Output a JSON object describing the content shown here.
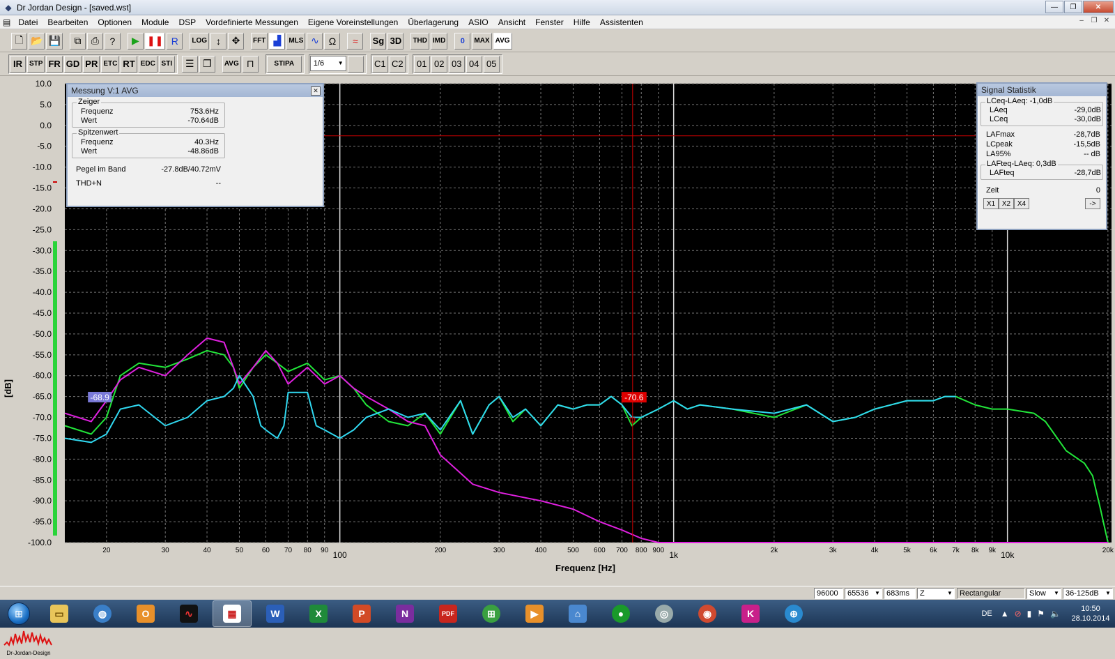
{
  "window": {
    "title": "Dr Jordan Design - [saved.wst]"
  },
  "menu": [
    "Datei",
    "Bearbeiten",
    "Optionen",
    "Module",
    "DSP",
    "Vordefinierte Messungen",
    "Eigene Voreinstellungen",
    "Überlagerung",
    "ASIO",
    "Ansicht",
    "Fenster",
    "Hilfe",
    "Assistenten"
  ],
  "toolbar1": [
    "LOG",
    "FFT",
    "MLS",
    "Sg",
    "3D",
    "THD",
    "IMD",
    "0",
    "MAX",
    "AVG",
    "R"
  ],
  "toolbar2": {
    "analysis_buttons": [
      "IR",
      "STP",
      "FR",
      "GD",
      "PR",
      "ETC",
      "RT",
      "EDC",
      "STI"
    ],
    "avg_label": "AVG",
    "stipa_label": "STIPA",
    "fraction": "1/6",
    "channels": [
      "C1",
      "C2"
    ],
    "slots": [
      "01",
      "02",
      "03",
      "04",
      "05"
    ]
  },
  "plot": {
    "y_axis_title": "[dB]",
    "x_axis_title": "Frequenz [Hz]",
    "y_ticks": [
      "10.0",
      "5.0",
      "0.0",
      "-5.0",
      "-10.0",
      "-15.0",
      "-20.0",
      "-25.0",
      "-30.0",
      "-35.0",
      "-40.0",
      "-45.0",
      "-50.0",
      "-55.0",
      "-60.0",
      "-65.0",
      "-70.0",
      "-75.0",
      "-80.0",
      "-85.0",
      "-90.0",
      "-95.0",
      "-100.0"
    ],
    "x_ticks": [
      "20",
      "30",
      "40",
      "50",
      "60",
      "70",
      "80",
      "90",
      "100",
      "200",
      "300",
      "400",
      "500",
      "600",
      "700",
      "800",
      "900",
      "1k",
      "2k",
      "3k",
      "4k",
      "5k",
      "6k",
      "7k",
      "8k",
      "9k",
      "10k",
      "20k"
    ],
    "cursor_label": "-70.6",
    "marker_label": "-68.9"
  },
  "chart_data": {
    "type": "line",
    "xlabel": "Frequenz [Hz]",
    "ylabel": "[dB]",
    "x_scale": "log",
    "xlim": [
      15,
      20500
    ],
    "ylim": [
      -100,
      10
    ],
    "grid": true,
    "cursor": {
      "frequency_hz": 753.6,
      "level_db": -70.6
    },
    "series": [
      {
        "color": "#22e63a",
        "x": [
          15,
          18,
          20,
          22,
          25,
          30,
          35,
          40,
          45,
          48,
          50,
          55,
          60,
          65,
          70,
          80,
          90,
          100,
          110,
          120,
          140,
          160,
          180,
          200,
          230,
          250,
          280,
          300,
          330,
          360,
          400,
          450,
          500,
          550,
          600,
          650,
          700,
          750,
          800,
          900,
          1000,
          1100,
          1200,
          1500,
          2000,
          2500,
          3000,
          3500,
          4000,
          5000,
          6000,
          6500,
          7000,
          8000,
          9000,
          10000,
          12000,
          13000,
          15000,
          17000,
          18000,
          19000,
          20000
        ],
        "y": [
          -72,
          -74,
          -70,
          -60,
          -57,
          -58,
          -56,
          -54,
          -55,
          -58,
          -63,
          -58,
          -55,
          -57,
          -59,
          -57,
          -61,
          -60,
          -63,
          -67,
          -71,
          -72,
          -69,
          -74,
          -66,
          -74,
          -67,
          -65,
          -71,
          -68,
          -72,
          -67,
          -68,
          -67,
          -67,
          -65,
          -67,
          -72,
          -70,
          -68,
          -66,
          -68,
          -67,
          -68,
          -70,
          -67,
          -71,
          -70,
          -68,
          -66,
          -66,
          -65,
          -65,
          -67,
          -68,
          -68,
          -69,
          -71,
          -78,
          -81,
          -84,
          -92,
          -100
        ]
      },
      {
        "color": "#e020e0",
        "x": [
          15,
          18,
          20,
          22,
          25,
          30,
          35,
          40,
          45,
          48,
          50,
          55,
          60,
          65,
          70,
          80,
          90,
          100,
          110,
          120,
          140,
          160,
          180,
          200,
          250,
          300,
          400,
          500,
          600,
          700,
          800,
          900,
          1000,
          2000,
          5000,
          10000,
          20000
        ],
        "y": [
          -69,
          -71,
          -66,
          -61,
          -58,
          -60,
          -55,
          -51,
          -52,
          -58,
          -62,
          -58,
          -54,
          -57,
          -62,
          -58,
          -62,
          -60,
          -63,
          -65,
          -68,
          -71,
          -72,
          -79,
          -86,
          -88,
          -90,
          -92,
          -95,
          -97,
          -99,
          -100,
          -100,
          -100,
          -100,
          -100,
          -100
        ]
      },
      {
        "color": "#30d8f0",
        "x": [
          15,
          18,
          20,
          22,
          25,
          30,
          35,
          40,
          45,
          48,
          50,
          55,
          58,
          60,
          65,
          68,
          70,
          80,
          85,
          90,
          100,
          110,
          120,
          140,
          160,
          180,
          200,
          230,
          250,
          280,
          300,
          330,
          360,
          400,
          450,
          500,
          550,
          600,
          650,
          700,
          750,
          800,
          900,
          1000,
          1100,
          1200,
          1500,
          2000,
          2500,
          3000,
          3500,
          4000,
          5000,
          6000,
          6500,
          7000
        ],
        "y": [
          -75,
          -76,
          -74,
          -68,
          -67,
          -72,
          -70,
          -66,
          -65,
          -63,
          -60,
          -65,
          -72,
          -73,
          -75,
          -72,
          -64,
          -64,
          -72,
          -73,
          -75,
          -73,
          -70,
          -68,
          -70,
          -69,
          -73,
          -66,
          -74,
          -67,
          -65,
          -70,
          -68,
          -72,
          -67,
          -68,
          -67,
          -67,
          -65,
          -67,
          -70,
          -70,
          -68,
          -66,
          -68,
          -67,
          -68,
          -69,
          -67,
          -71,
          -70,
          -68,
          -66,
          -66,
          -65,
          -65
        ]
      }
    ]
  },
  "measure_dialog": {
    "title": "Messung V:1 AVG",
    "zeiger_label": "Zeiger",
    "zeiger_freq_label": "Frequenz",
    "zeiger_freq": "753.6Hz",
    "zeiger_wert_label": "Wert",
    "zeiger_wert": "-70.64dB",
    "spitze_label": "Spitzenwert",
    "spitze_freq_label": "Frequenz",
    "spitze_freq": "40.3Hz",
    "spitze_wert_label": "Wert",
    "spitze_wert": "-48.86dB",
    "pegel_label": "Pegel im Band",
    "pegel": "-27.8dB/40.72mV",
    "thd_label": "THD+N",
    "thd": "--"
  },
  "signal_dialog": {
    "title": "Signal Statistik",
    "lceq_group": "LCeq-LAeq: -1,0dB",
    "laeq_label": "LAeq",
    "laeq": "-29,0dB",
    "lceq_label": "LCeq",
    "lceq": "-30,0dB",
    "lafmax_label": "LAFmax",
    "lafmax": "-28,7dB",
    "lcpeak_label": "LCpeak",
    "lcpeak": "-15,5dB",
    "la95_label": "LA95%",
    "la95": "-- dB",
    "lafteq_group": "LAFteq-LAeq: 0,3dB",
    "lafteq_label": "LAFteq",
    "lafteq": "-28,7dB",
    "zeit_label": "Zeit",
    "zeit": "0",
    "buttons": [
      "X1",
      "X2",
      "X4",
      "->"
    ]
  },
  "statusbar": {
    "samplerate": "96000",
    "fft_size": "65536",
    "time": "683ms",
    "weighting": "Z",
    "window": "Rectangular",
    "speed": "Slow",
    "range": "36-125dB"
  },
  "logo_text": "Dr-Jordan-Design",
  "taskbar": {
    "lang": "DE",
    "time": "10:50",
    "date": "28.10.2014"
  },
  "colors": {
    "plot_bg": "#000000",
    "green": "#22e63a",
    "magenta": "#e020e0",
    "cyan": "#30d8f0",
    "cursor": "#cc0000"
  }
}
